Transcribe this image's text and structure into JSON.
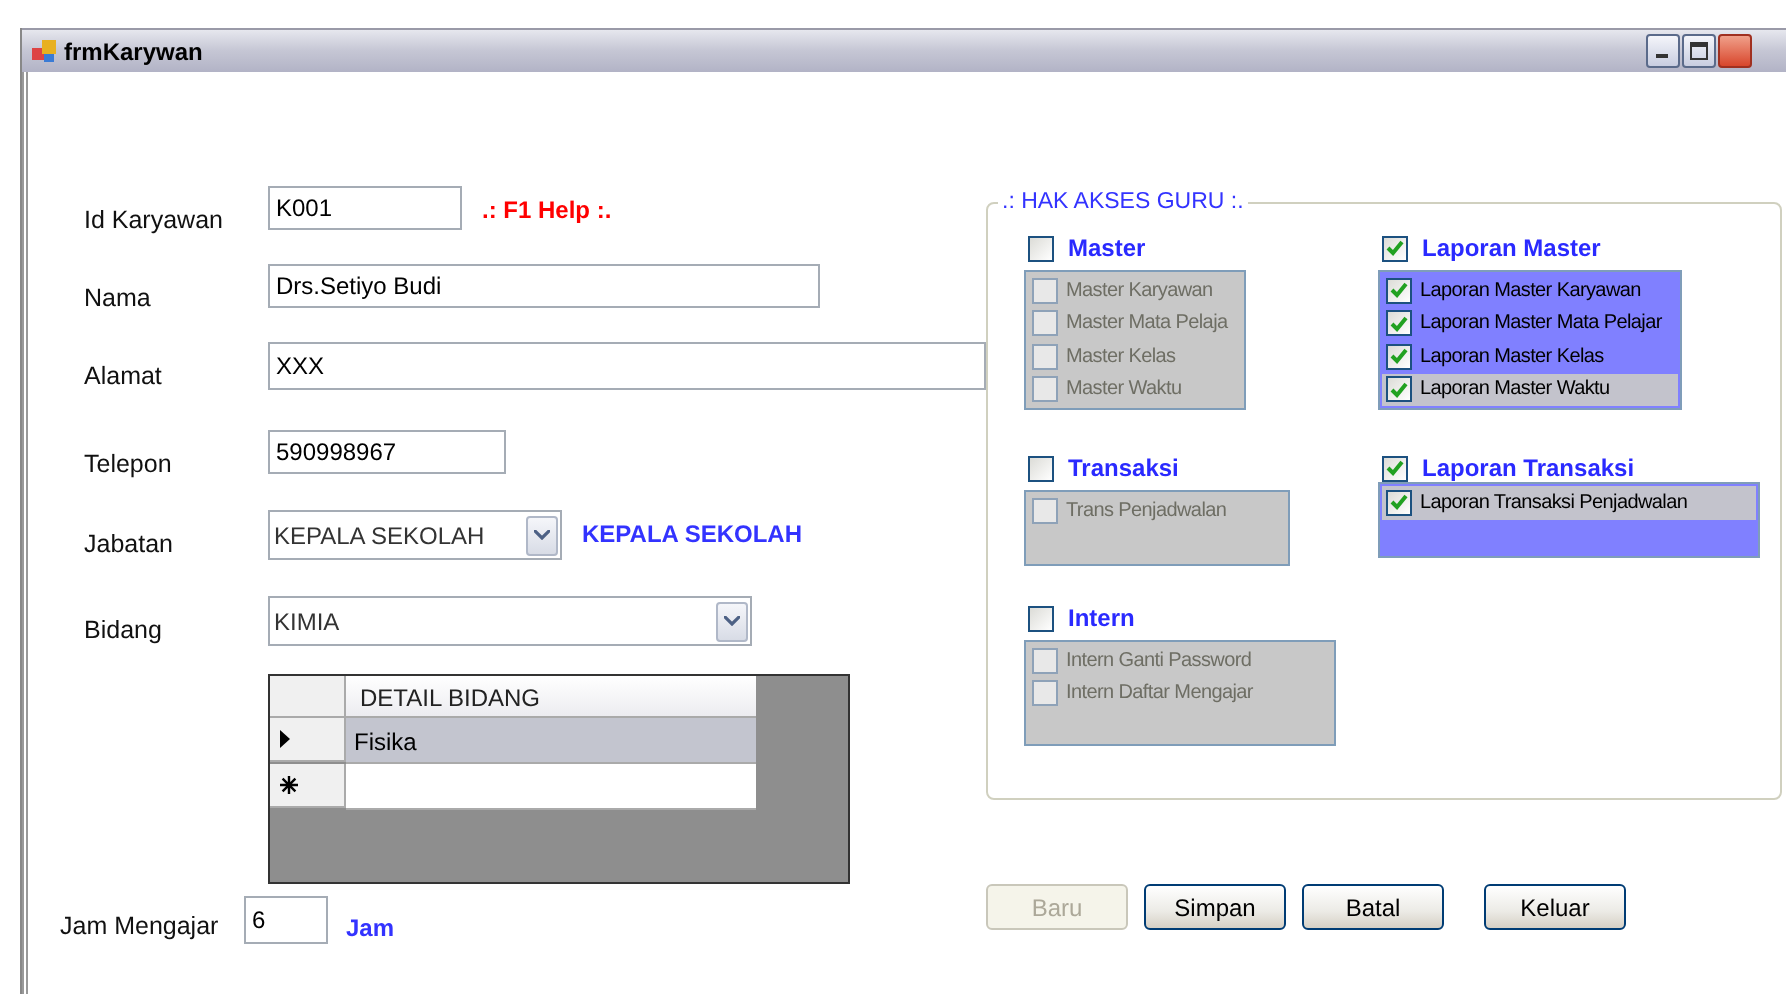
{
  "window": {
    "title": "frmKarywan"
  },
  "fields": [
    {
      "kind": "text",
      "label": "Id Karyawan",
      "value": "K001",
      "note": {
        "text": ".: F1 Help :.",
        "color": "#ff0000"
      }
    },
    {
      "kind": "text",
      "label": "Nama",
      "value": "Drs.Setiyo Budi"
    },
    {
      "kind": "text",
      "label": "Alamat",
      "value": "XXX"
    },
    {
      "kind": "text",
      "label": "Telepon",
      "value": "590998967"
    },
    {
      "kind": "combo",
      "label": "Jabatan",
      "value": "KEPALA SEKOLAH",
      "note": {
        "text": "KEPALA SEKOLAH",
        "color": "#3333ff"
      }
    },
    {
      "kind": "combo",
      "label": "Bidang",
      "value": "KIMIA"
    },
    {
      "kind": "grid",
      "columns": [
        "DETAIL BIDANG"
      ],
      "rows": [
        {
          "kind": "current",
          "selected": true,
          "cells": [
            "Fisika"
          ]
        },
        {
          "kind": "new",
          "selected": false,
          "cells": []
        }
      ]
    },
    {
      "kind": "text",
      "label": "Jam Mengajar",
      "value": "6",
      "note": {
        "text": "Jam",
        "color": "#3333ff"
      }
    }
  ],
  "access": {
    "title": ".: HAK AKSES GURU :.",
    "sections": [
      {
        "title": "Master",
        "checked": false,
        "items": [
          {
            "label": "Master Karyawan",
            "checked": false,
            "selected": false
          },
          {
            "label": "Master Mata Pelaja",
            "checked": false,
            "selected": false
          },
          {
            "label": "Master Kelas",
            "checked": false,
            "selected": false
          },
          {
            "label": "Master Waktu",
            "checked": false,
            "selected": false
          }
        ]
      },
      {
        "title": "Laporan Master",
        "checked": true,
        "items": [
          {
            "label": "Laporan Master Karyawan",
            "checked": true,
            "selected": false
          },
          {
            "label": "Laporan Master Mata Pelajar",
            "checked": true,
            "selected": false
          },
          {
            "label": "Laporan Master Kelas",
            "checked": true,
            "selected": false
          },
          {
            "label": "Laporan Master Waktu",
            "checked": true,
            "selected": true
          }
        ]
      },
      {
        "title": "Transaksi",
        "checked": false,
        "items": [
          {
            "label": "Trans Penjadwalan",
            "checked": false,
            "selected": false
          }
        ]
      },
      {
        "title": "Laporan Transaksi",
        "checked": true,
        "items": [
          {
            "label": "Laporan Transaksi Penjadwalan",
            "checked": true,
            "selected": true
          }
        ]
      },
      {
        "title": "Intern",
        "checked": false,
        "items": [
          {
            "label": "Intern Ganti Password",
            "checked": false,
            "selected": false
          },
          {
            "label": "Intern Daftar Mengajar",
            "checked": false,
            "selected": false
          }
        ]
      }
    ]
  },
  "buttons": [
    {
      "label": "Baru",
      "disabled": true
    },
    {
      "label": "Simpan",
      "disabled": false
    },
    {
      "label": "Batal",
      "disabled": false
    },
    {
      "label": "Keluar",
      "disabled": false
    }
  ]
}
